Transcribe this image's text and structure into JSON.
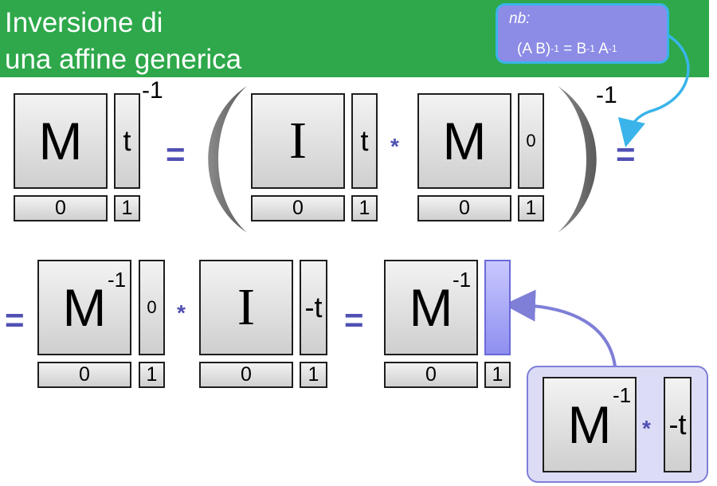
{
  "header": {
    "title_line1": "Inversione di",
    "title_line2": "una affine generica",
    "background_color": "#2ea84a"
  },
  "note": {
    "label": "nb:",
    "formula_lhs": "(A B)",
    "exp_inv": "-1",
    "equals": "=",
    "b": "B",
    "a": "A"
  },
  "equation_1": {
    "lhs": {
      "matrix": "M",
      "column": "t",
      "row_value": "0",
      "corner": "1",
      "exponent": "-1"
    },
    "equals": "=",
    "factor1": {
      "matrix": "I",
      "column": "t",
      "row_value": "0",
      "corner": "1"
    },
    "times": "*",
    "factor2": {
      "matrix": "M",
      "column": "0",
      "row_value": "0",
      "corner": "1"
    },
    "exponent": "-1",
    "trailing_equals": "="
  },
  "equation_2": {
    "leading_equals": "=",
    "factor1": {
      "matrix": "M",
      "matrix_exponent": "-1",
      "column": "0",
      "row_value": "0",
      "corner": "1"
    },
    "times": "*",
    "factor2": {
      "matrix": "I",
      "column": "-t",
      "row_value": "0",
      "corner": "1"
    },
    "equals": "=",
    "result": {
      "matrix": "M",
      "matrix_exponent": "-1",
      "column": "",
      "row_value": "0",
      "corner": "1"
    }
  },
  "callout": {
    "matrix": "M",
    "matrix_exponent": "-1",
    "times": "*",
    "column": "-t"
  },
  "colors": {
    "operator": "#5050b4",
    "highlight": "#8f8ff0",
    "arrow_blue": "#3ab4ea",
    "arrow_purple": "#7f7fd8"
  }
}
